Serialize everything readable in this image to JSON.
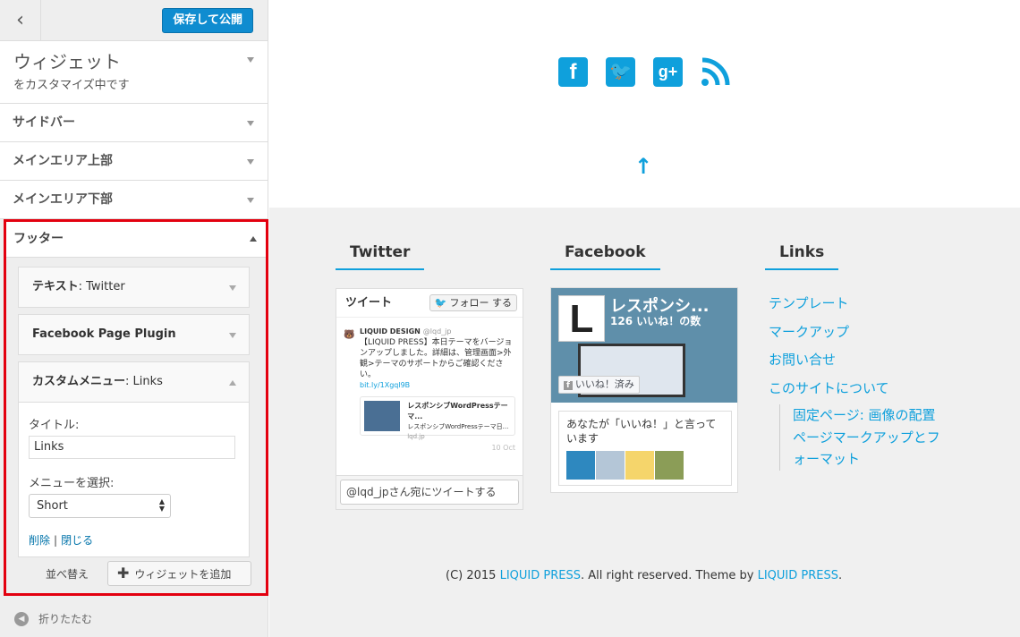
{
  "sidebar": {
    "back_label": "‹",
    "save_label": "保存して公開",
    "panel_title": "ウィジェット",
    "panel_subtitle": "をカスタマイズ中です",
    "sections": [
      {
        "label": "サイドバー"
      },
      {
        "label": "メインエリア上部"
      },
      {
        "label": "メインエリア下部"
      }
    ],
    "footer_section": {
      "label": "フッター",
      "widgets": [
        {
          "type_label": "テキスト",
          "title_suffix": ": Twitter"
        },
        {
          "type_label": "Facebook Page Plugin",
          "title_suffix": ""
        },
        {
          "type_label": "カスタムメニュー",
          "title_suffix": ": Links"
        }
      ],
      "form": {
        "title_label": "タイトル:",
        "title_value": "Links",
        "menu_label": "メニューを選択:",
        "menu_value": "Short",
        "delete_label": "削除",
        "separator": "|",
        "close_label": "閉じる"
      },
      "reorder_label": "並べ替え",
      "add_widget_label": "ウィジェットを追加"
    },
    "collapse_label": "折りたたむ"
  },
  "preview": {
    "social_icons": [
      "facebook-icon",
      "twitter-icon",
      "google-plus-icon",
      "rss-icon"
    ],
    "twitter": {
      "heading": "Twitter",
      "box_title": "ツイート",
      "follow_label": "フォロー する",
      "tweet_author": "LIQUID DESIGN",
      "tweet_handle": "@lqd_jp",
      "tweet_text": "【LIQUID PRESS】本日テーマをバージョンアップしました。詳細は、管理画面>外観>テーマのサポートからご確認ください。",
      "tweet_link": "bit.ly/1Xgql9B",
      "card_title": "レスポンシブWordPressテーマ...",
      "card_desc": "レスポンシブWordPressテーマ日...",
      "card_domain": "lqd.jp",
      "tweet_date": "10 Oct",
      "compose_placeholder": "@lqd_jpさん宛にツイートする"
    },
    "facebook": {
      "heading": "Facebook",
      "page_name": "レスポンシ...",
      "like_count": "126 いいね！の数",
      "like_button": "いいね！済み",
      "friends_text": "あなたが「いいね！」と言っています",
      "swatch_colors": [
        "#2e88bf",
        "#b4c6d7",
        "#f5d56b",
        "#8b9d57"
      ]
    },
    "links": {
      "heading": "Links",
      "items": [
        "テンプレート",
        "マークアップ",
        "お問い合せ",
        "このサイトについて"
      ],
      "sub_items": [
        "固定ページ: 画像の配置",
        "ページマークアップとフ",
        "ォーマット"
      ]
    },
    "credits": {
      "prefix": "(C) 2015 ",
      "link1": "LIQUID PRESS",
      "middle": ". All right reserved. Theme by ",
      "link2": "LIQUID PRESS",
      "suffix": "."
    }
  },
  "colors": {
    "accent": "#0fa0dc",
    "highlight_border": "#e3000f",
    "save_button": "#0f8cd0"
  }
}
